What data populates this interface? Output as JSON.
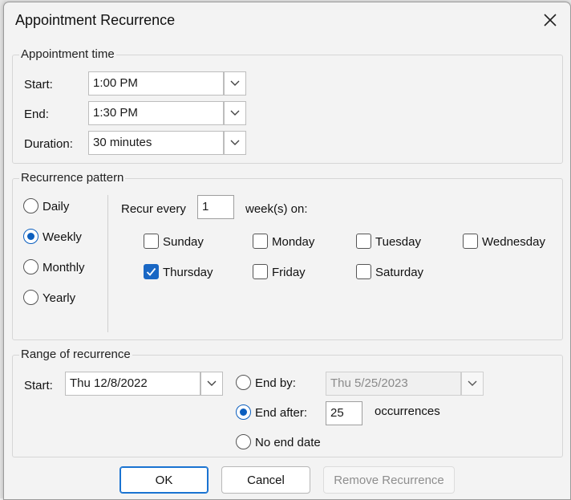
{
  "dialog": {
    "title": "Appointment Recurrence"
  },
  "appointment_time": {
    "legend": "Appointment time",
    "start_label": "Start:",
    "start_value": "1:00 PM",
    "end_label": "End:",
    "end_value": "1:30 PM",
    "duration_label": "Duration:",
    "duration_value": "30 minutes"
  },
  "recurrence_pattern": {
    "legend": "Recurrence pattern",
    "frequencies": [
      {
        "label": "Daily",
        "selected": false
      },
      {
        "label": "Weekly",
        "selected": true
      },
      {
        "label": "Monthly",
        "selected": false
      },
      {
        "label": "Yearly",
        "selected": false
      }
    ],
    "recur_every_label": "Recur every",
    "recur_every_value": "1",
    "weeks_on_label": "week(s) on:",
    "days": [
      {
        "label": "Sunday",
        "checked": false
      },
      {
        "label": "Monday",
        "checked": false
      },
      {
        "label": "Tuesday",
        "checked": false
      },
      {
        "label": "Wednesday",
        "checked": false
      },
      {
        "label": "Thursday",
        "checked": true
      },
      {
        "label": "Friday",
        "checked": false
      },
      {
        "label": "Saturday",
        "checked": false
      }
    ]
  },
  "range": {
    "legend": "Range of recurrence",
    "start_label": "Start:",
    "start_value": "Thu 12/8/2022",
    "end_by_label": "End by:",
    "end_by_value": "Thu 5/25/2023",
    "end_after_label": "End after:",
    "end_after_value": "25",
    "occurrences_label": "occurrences",
    "no_end_label": "No end date",
    "selected": "end_after"
  },
  "buttons": {
    "ok": "OK",
    "cancel": "Cancel",
    "remove": "Remove Recurrence"
  },
  "colors": {
    "accent": "#1967c4"
  }
}
